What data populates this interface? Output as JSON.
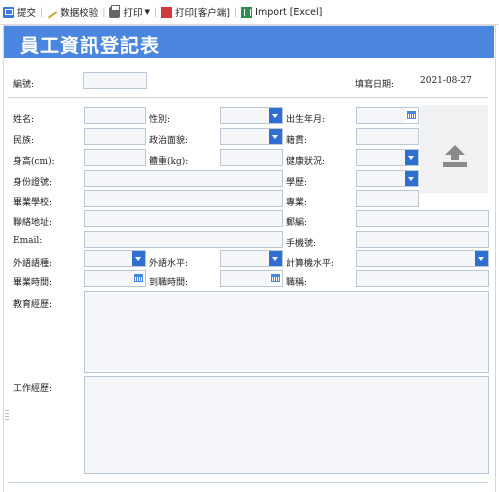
{
  "toolbar": {
    "submit": "提交",
    "validate": "数据校验",
    "print": "打印",
    "print_client": "打印[客户端]",
    "import_excel": "Import [Excel]"
  },
  "form": {
    "title": "員工資訊登記表",
    "number_label": "編號:",
    "number_value": "",
    "fill_date_label": "填寫日期:",
    "fill_date_value": "2021-08-27",
    "labels": {
      "name": "姓名:",
      "gender": "性別:",
      "birth": "出生年月:",
      "ethnicity": "民族:",
      "political": "政治面貌:",
      "native_place": "籍貫:",
      "height": "身高(cm):",
      "weight": "體重(kg):",
      "health": "健康狀況:",
      "id_number": "身份證號:",
      "education": "學歷:",
      "school": "畢業學校:",
      "major": "專業:",
      "address": "聯絡地址:",
      "postcode": "郵編:",
      "email": "Email:",
      "mobile": "手機號:",
      "language": "外語語種:",
      "language_level": "外語水平:",
      "computer_level": "計算機水平:",
      "graduation_time": "畢業時間:",
      "start_time": "到職時間:",
      "title": "職稱:",
      "edu_experience": "教育經歷:",
      "work_experience": "工作經歷:"
    }
  },
  "colors": {
    "accent": "#4a86e0",
    "dropdown": "#2f6fd0",
    "field_bg": "#f4f6f9",
    "field_border": "#b9c7d6"
  },
  "icons": {
    "submit": "submit-icon",
    "validate": "wand-icon",
    "print": "printer-icon",
    "print_client": "pdf-icon",
    "import": "excel-icon",
    "photo": "upload-icon"
  }
}
